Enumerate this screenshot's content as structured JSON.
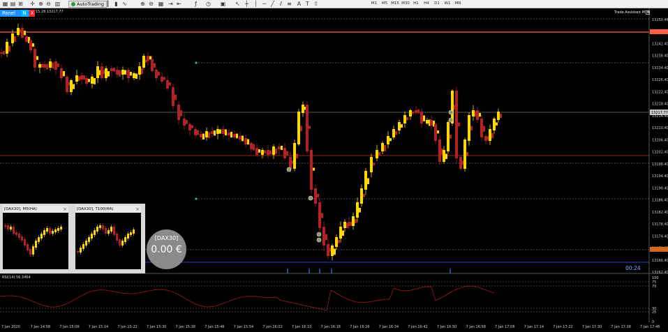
{
  "toolbar": {
    "autotrading_label": "AutoTrading",
    "timeframes": [
      "M1",
      "M5",
      "M15",
      "M30",
      "H1",
      "H4",
      "D1",
      "W1",
      "MN"
    ]
  },
  "chart": {
    "ohlc": "28 13216.78 13215.28 13217.77",
    "panel_label": "Panel",
    "panel_n": "N",
    "panel_x": "X",
    "trade_assistant": "Trade Assistant MT4",
    "close_glyph": "x",
    "price_labels": [
      "13250.46",
      "13246.90",
      "13242.40",
      "13238.40",
      "13234.40",
      "13226.40",
      "13222.40",
      "13218.40",
      "13214.40",
      "13210.40",
      "13206.40",
      "13202.40",
      "13198.40",
      "13194.40",
      "13190.40",
      "13186.40",
      "13182.40",
      "13178.40",
      "13174.40",
      "13170.00",
      "13166.40",
      "13162.40"
    ],
    "time_labels": [
      "7 Jan 2020",
      "7 Jan 14:58",
      "7 Jan 15:06",
      "7 Jan 15:14",
      "7 Jan 15:22",
      "7 Jan 15:30",
      "7 Jan 15:38",
      "7 Jan 15:46",
      "7 Jan 15:54",
      "7 Jan 16:02",
      "7 Jan 16:10",
      "7 Jan 16:18",
      "7 Jan 16:26",
      "7 Jan 16:34",
      "7 Jan 16:42",
      "7 Jan 16:50",
      "7 Jan 16:58",
      "7 Jan 17:06",
      "7 Jan 17:14",
      "7 Jan 17:22",
      "7 Jan 17:30",
      "7 Jan 17:38",
      "7 Jan 17:46"
    ],
    "current_price": "13217.77",
    "timer": "00:24",
    "colors": {
      "bull": "#ffd700",
      "bear": "#b22222",
      "hline_red": "#ff6347",
      "grid": "#7d7d7d"
    }
  },
  "minis": [
    {
      "title": "[DAX30], M5(HA)",
      "close": "×"
    },
    {
      "title": "[DAX30], T100(HA)",
      "close": "×"
    }
  ],
  "pl": {
    "symbol": "[DAX30]",
    "value": "0.00 €"
  },
  "rsi": {
    "label": "RSI(14) 56.3464",
    "levels": [
      "100",
      "75",
      "70",
      "30",
      "25",
      "0"
    ]
  }
}
